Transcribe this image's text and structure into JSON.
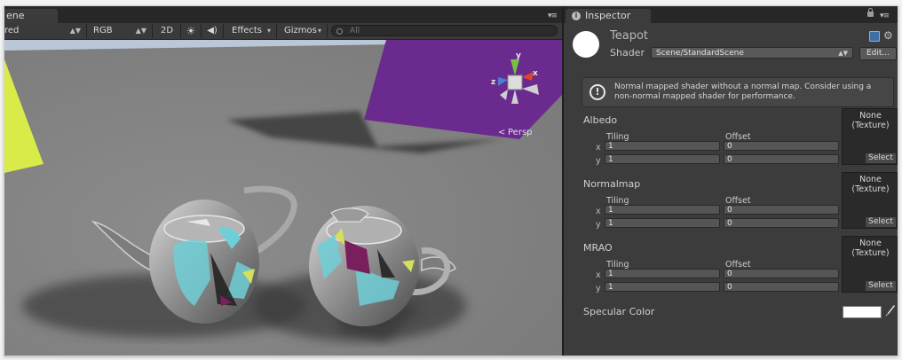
{
  "scene": {
    "tab_label": "ene",
    "toolbar": {
      "draw_mode": "red",
      "channels": "RGB",
      "mode_2d": "2D",
      "effects": "Effects",
      "gizmos": "Gizmos",
      "search_placeholder": "All"
    },
    "gizmo": {
      "axis_x": "x",
      "axis_y": "y",
      "axis_z": "z",
      "projection": "Persp"
    }
  },
  "inspector": {
    "tab_label": "Inspector",
    "material_name": "Teapot",
    "shader_label": "Shader",
    "shader_value": "Scene/StandardScene",
    "edit_button": "Edit...",
    "help_message": "Normal mapped shader without a normal map. Consider using a non-normal mapped shader for performance.",
    "properties": [
      {
        "label": "Albedo",
        "tiling_label": "Tiling",
        "offset_label": "Offset",
        "tiling_x": "1",
        "tiling_y": "1",
        "offset_x": "0",
        "offset_y": "0",
        "texture_text": "None\n(Texture)",
        "select_label": "Select"
      },
      {
        "label": "Normalmap",
        "tiling_label": "Tiling",
        "offset_label": "Offset",
        "tiling_x": "1",
        "tiling_y": "1",
        "offset_x": "0",
        "offset_y": "0",
        "texture_text": "None\n(Texture)",
        "select_label": "Select"
      },
      {
        "label": "MRAO",
        "tiling_label": "Tiling",
        "offset_label": "Offset",
        "tiling_x": "1",
        "tiling_y": "1",
        "offset_x": "0",
        "offset_y": "0",
        "texture_text": "None\n(Texture)",
        "select_label": "Select"
      }
    ],
    "axis_x": "x",
    "axis_y": "y",
    "specular_label": "Specular Color",
    "specular_color": "#ffffff"
  }
}
